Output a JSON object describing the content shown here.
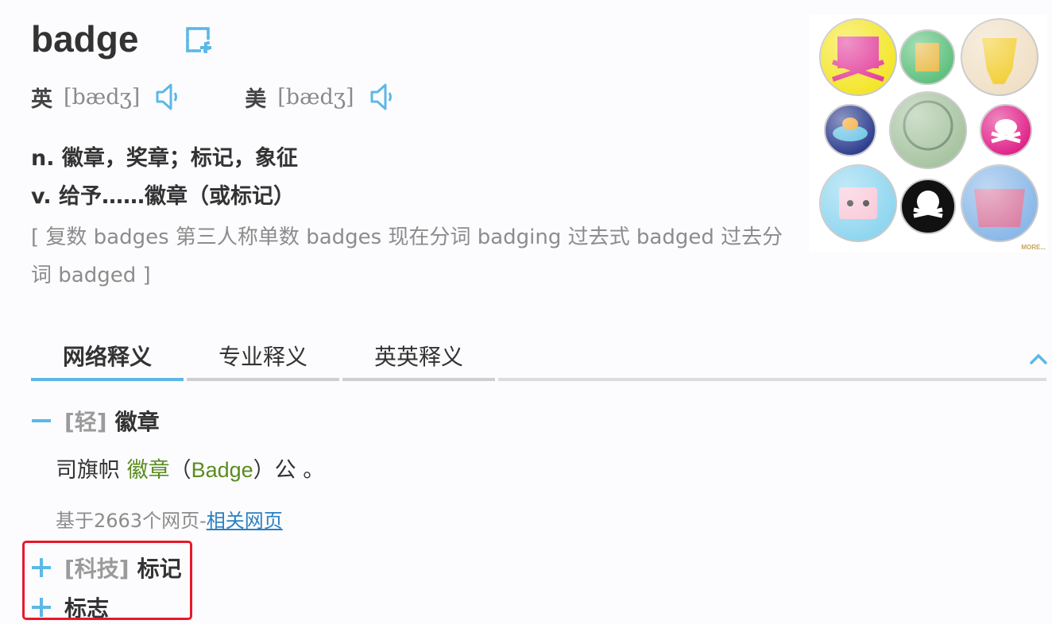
{
  "word": "badge",
  "pronunciation": {
    "uk": {
      "region": "英",
      "phonetic": "[bædʒ]"
    },
    "us": {
      "region": "美",
      "phonetic": "[bædʒ]"
    }
  },
  "definitions": [
    "n. 徽章，奖章；标记，象征",
    "v. 给予……徽章（或标记）"
  ],
  "inflections": "[ 复数 badges 第三人称单数 badges 现在分词 badging 过去式 badged 过去分词 badged ]",
  "image": {
    "more_label": "MORE..."
  },
  "tabs": [
    {
      "label": "网络释义",
      "active": true
    },
    {
      "label": "专业释义",
      "active": false
    },
    {
      "label": "英英释义",
      "active": false
    }
  ],
  "web_senses": [
    {
      "toggle": "minus",
      "tag": "[轻]",
      "meaning": "徽章",
      "expanded": true
    },
    {
      "toggle": "plus",
      "tag": "[科技]",
      "meaning": "标记",
      "expanded": false
    },
    {
      "toggle": "plus",
      "tag": "",
      "meaning": "标志",
      "expanded": false
    }
  ],
  "example": {
    "prefix": "司旗帜 ",
    "highlight": "徽章",
    "open_paren": "（",
    "english": "Badge",
    "close_paren": "）公 。"
  },
  "source": {
    "text": "基于2663个网页-",
    "link": "相关网页"
  },
  "colors": {
    "accent_blue": "#5cb8e6",
    "highlight_green": "#5a8c1e",
    "link_blue": "#2b7fc0",
    "annotation_red": "#e8182b"
  }
}
